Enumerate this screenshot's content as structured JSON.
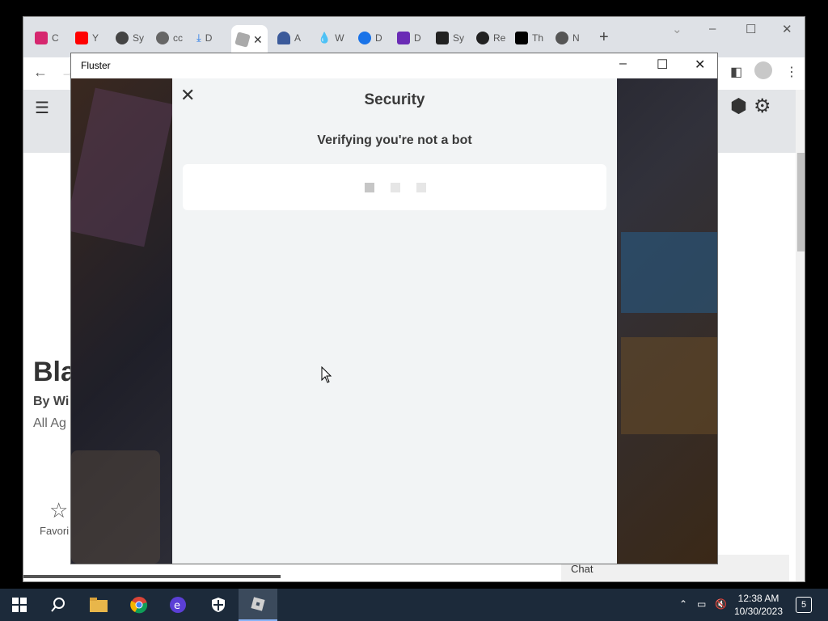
{
  "browser": {
    "tabs": [
      {
        "label": "C",
        "icon": "pink-square-icon",
        "color": "#d6276f"
      },
      {
        "label": "Y",
        "icon": "youtube-icon",
        "color": "#ff0000"
      },
      {
        "label": "Sy",
        "icon": "sync-icon",
        "color": "#444444"
      },
      {
        "label": "cc",
        "icon": "globe-icon",
        "color": "#555555"
      },
      {
        "label": "D",
        "icon": "download-icon",
        "color": "#1a73e8"
      },
      {
        "label": "",
        "icon": "roblox-icon",
        "color": "#888888"
      },
      {
        "label": "A",
        "icon": "car-icon",
        "color": "#3b5a9a"
      },
      {
        "label": "W",
        "icon": "drop-icon",
        "color": "#29a0d8"
      },
      {
        "label": "D",
        "icon": "share-icon",
        "color": "#1a73e8"
      },
      {
        "label": "D",
        "icon": "square-icon",
        "color": "#6a2bb5"
      },
      {
        "label": "Sy",
        "icon": "dark-square-icon",
        "color": "#222222"
      },
      {
        "label": "Re",
        "icon": "github-icon",
        "color": "#222222"
      },
      {
        "label": "Th",
        "icon": "threads-icon",
        "color": "#000000"
      },
      {
        "label": "N",
        "icon": "chrome-icon",
        "color": "#555555"
      }
    ],
    "new_tab": "+",
    "minimize": "–",
    "maximize": "☐",
    "close": "✕"
  },
  "page": {
    "game_title": "Bla",
    "by": "By Wi",
    "age": "All Ag",
    "favorite": "Favori",
    "chat": "Chat"
  },
  "fluster": {
    "title": "Fluster",
    "minimize": "–",
    "maximize": "☐",
    "close": "✕"
  },
  "modal": {
    "close": "✕",
    "title": "Security",
    "subtitle": "Verifying you're not a bot"
  },
  "taskbar": {
    "time": "12:38 AM",
    "date": "10/30/2023",
    "notifications": "5"
  }
}
